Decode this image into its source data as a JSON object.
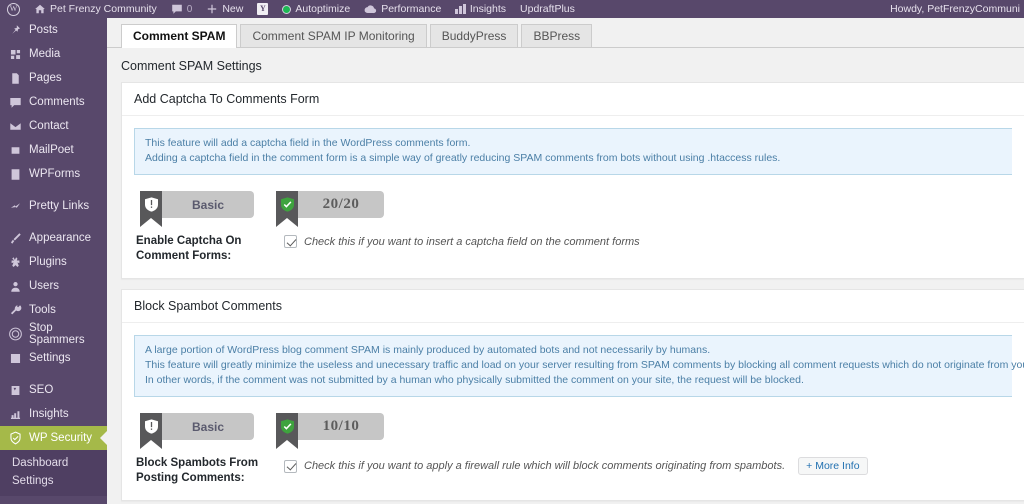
{
  "adminbar": {
    "logo_icon": "wordpress-logo-icon",
    "site_name": "Pet Frenzy Community",
    "site_icon": "home-icon",
    "comments_icon": "comment-bubble-icon",
    "comments_count": "0",
    "new_icon": "plus-icon",
    "new_label": "New",
    "yoast_icon": "yoast-seo-icon",
    "autoptimize_icon": "autoptimize-status-icon",
    "autoptimize_label": "Autoptimize",
    "performance_icon": "performance-cloud-icon",
    "performance_label": "Performance",
    "insights_icon": "insights-bars-icon",
    "insights_label": "Insights",
    "updraft_label": "UpdraftPlus",
    "howdy": "Howdy, PetFrenzyCommuni"
  },
  "sidebar": {
    "items": [
      {
        "label": "Posts",
        "icon": "pin-icon"
      },
      {
        "label": "Media",
        "icon": "media-icon"
      },
      {
        "label": "Pages",
        "icon": "page-icon"
      },
      {
        "label": "Comments",
        "icon": "comment-bubble-icon"
      },
      {
        "label": "Contact",
        "icon": "envelope-icon"
      },
      {
        "label": "MailPoet",
        "icon": "mailpoet-icon"
      },
      {
        "label": "WPForms",
        "icon": "wpforms-icon"
      },
      {
        "label": "Pretty Links",
        "icon": "pretty-links-icon",
        "gap_before": true
      },
      {
        "label": "Appearance",
        "icon": "paintbrush-icon",
        "gap_before": true
      },
      {
        "label": "Plugins",
        "icon": "plugin-icon"
      },
      {
        "label": "Users",
        "icon": "user-icon"
      },
      {
        "label": "Tools",
        "icon": "wrench-icon"
      },
      {
        "label": "Stop Spammers",
        "icon": "stop-spammers-icon"
      },
      {
        "label": "Settings",
        "icon": "settings-slider-icon"
      },
      {
        "label": "SEO",
        "icon": "yoast-seo-icon",
        "gap_before": true
      },
      {
        "label": "Insights",
        "icon": "insights-icon"
      },
      {
        "label": "WP Security",
        "icon": "shield-check-icon",
        "current": true
      }
    ],
    "submenu": [
      {
        "label": "Dashboard"
      },
      {
        "label": "Settings"
      }
    ],
    "current_color": "#a5b949",
    "background_color": "#58486b"
  },
  "main": {
    "tabs": [
      {
        "label": "Comment SPAM",
        "active": true
      },
      {
        "label": "Comment SPAM IP Monitoring",
        "active": false
      },
      {
        "label": "BuddyPress",
        "active": false
      },
      {
        "label": "BBPress",
        "active": false
      }
    ],
    "page_title": "Comment SPAM Settings",
    "panels": [
      {
        "heading": "Add Captcha To Comments Form",
        "notice": [
          "This feature will add a captcha field in the WordPress comments form.",
          "Adding a captcha field in the comment form is a simple way of greatly reducing SPAM comments from bots without using .htaccess rules."
        ],
        "ribbons": [
          {
            "icon": "shield-grey-icon",
            "label": "Basic",
            "kind": "label"
          },
          {
            "icon": "shield-green-check-icon",
            "label": "20/20",
            "kind": "score"
          }
        ],
        "row": {
          "label": "Enable Captcha On Comment Forms:",
          "checked": true,
          "hint": "Check this if you want to insert a captcha field on the comment forms",
          "more_info": null
        }
      },
      {
        "heading": "Block Spambot Comments",
        "notice": [
          "A large portion of WordPress blog comment SPAM is mainly produced by automated bots and not necessarily by humans.",
          "This feature will greatly minimize the useless and unecessary traffic and load on your server resulting from SPAM comments by blocking all comment requests which do not originate from your domain.",
          "In other words, if the comment was not submitted by a human who physically submitted the comment on your site, the request will be blocked."
        ],
        "ribbons": [
          {
            "icon": "shield-grey-icon",
            "label": "Basic",
            "kind": "label"
          },
          {
            "icon": "shield-green-check-icon",
            "label": "10/10",
            "kind": "score"
          }
        ],
        "row": {
          "label": "Block Spambots From Posting Comments:",
          "checked": true,
          "hint": "Check this if you want to apply a firewall rule which will block comments originating from spambots.",
          "more_info": "+ More Info"
        }
      }
    ]
  }
}
